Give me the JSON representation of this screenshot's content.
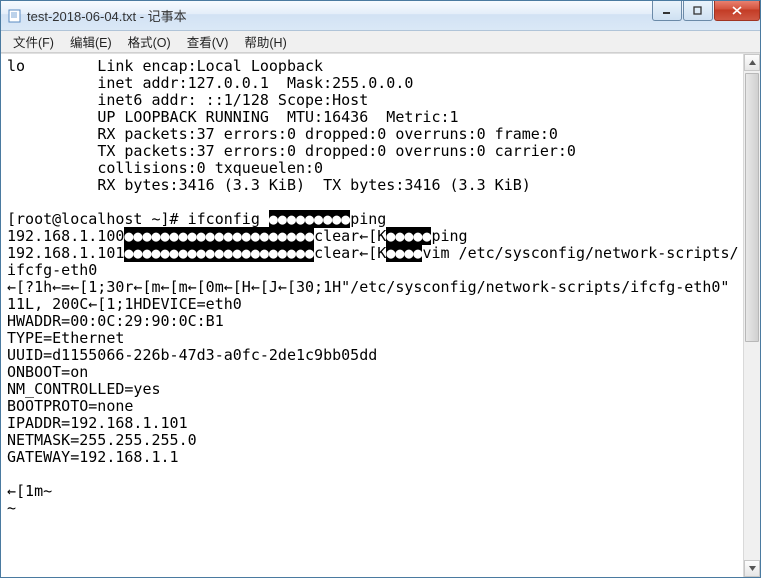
{
  "window": {
    "title": "test-2018-06-04.txt - 记事本"
  },
  "menu": {
    "file": "文件(F)",
    "edit": "编辑(E)",
    "format": "格式(O)",
    "view": "查看(V)",
    "help": "帮助(H)"
  },
  "body": {
    "l1": "lo        Link encap:Local Loopback",
    "l2": "          inet addr:127.0.0.1  Mask:255.0.0.0",
    "l3": "          inet6 addr: ::1/128 Scope:Host",
    "l4": "          UP LOOPBACK RUNNING  MTU:16436  Metric:1",
    "l5": "          RX packets:37 errors:0 dropped:0 overruns:0 frame:0",
    "l6": "          TX packets:37 errors:0 dropped:0 overruns:0 carrier:0",
    "l7": "          collisions:0 txqueuelen:0",
    "l8": "          RX bytes:3416 (3.3 KiB)  TX bytes:3416 (3.3 KiB)",
    "l9": "",
    "l10a": "[root@localhost ~]# ifconfig ",
    "l10b": "●●●●●●●●●",
    "l10c": "ping ",
    "l11a": "192.168.1.100",
    "l11b": "●●●●●●●●●●●●●●●●●●●●●",
    "l11c": "clear←[K",
    "l11d": "●●●●●",
    "l11e": "ping ",
    "l12a": "192.168.1.101",
    "l12b": "●●●●●●●●●●●●●●●●●●●●●",
    "l12c": "clear←[K",
    "l12d": "●●●●",
    "l12e": "vim /etc/sysconfig/network-scripts/ifcfg-eth0",
    "l13": "←[?1h←=←[1;30r←[m←[m←[0m←[H←[J←[30;1H\"/etc/sysconfig/network-scripts/ifcfg-eth0\" 11L, 200C←[1;1HDEVICE=eth0",
    "l14": "HWADDR=00:0C:29:90:0C:B1",
    "l15": "TYPE=Ethernet",
    "l16": "UUID=d1155066-226b-47d3-a0fc-2de1c9bb05dd",
    "l17": "ONBOOT=on",
    "l18": "NM_CONTROLLED=yes",
    "l19": "BOOTPROTO=none",
    "l20": "IPADDR=192.168.1.101",
    "l21": "NETMASK=255.255.255.0",
    "l22": "GATEWAY=192.168.1.1",
    "l23": "",
    "l24": "←[1m~"
  }
}
